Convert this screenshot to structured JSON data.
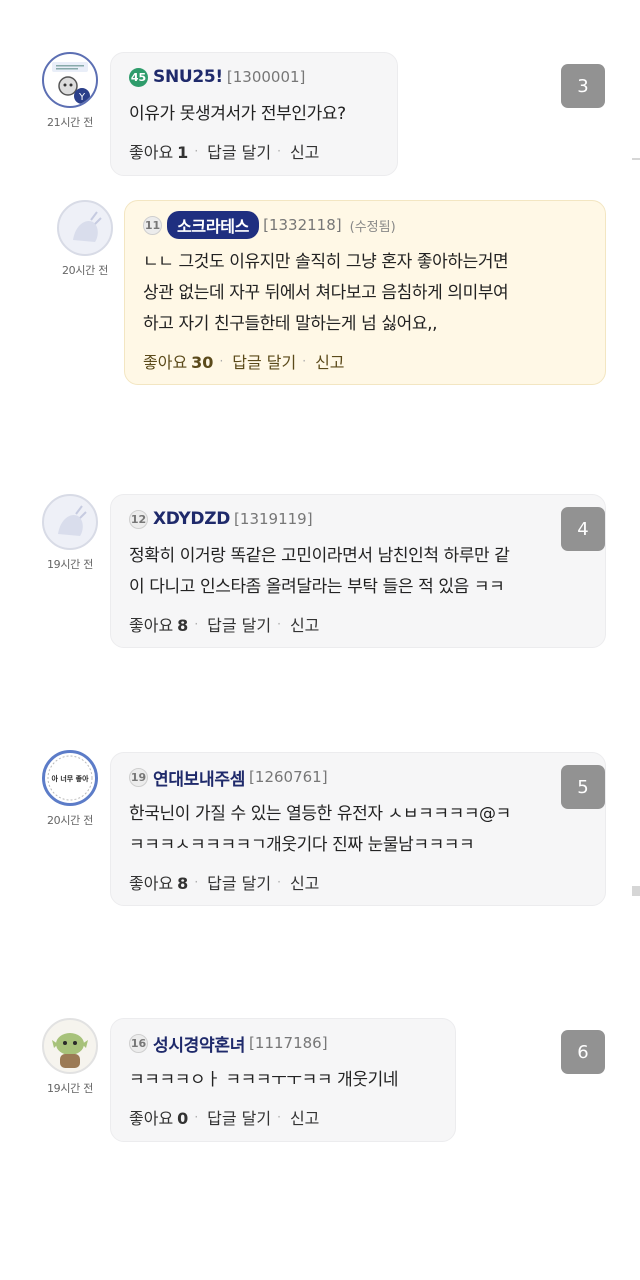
{
  "comments": [
    {
      "level": "45",
      "nickname": "SNU25!",
      "user_id": "[1300001]",
      "edited": "",
      "time": "21시간 전",
      "text_lines": [
        "이유가 못생겨서가 전부인가요?"
      ],
      "like_label": "좋아요",
      "like_count": "1",
      "reply_label": "답글 달기",
      "report_label": "신고",
      "badge": "3"
    },
    {
      "level": "11",
      "nickname": "소크라테스",
      "user_id": "[1332118]",
      "edited": "(수정됨)",
      "time": "20시간 전",
      "text_lines": [
        "ㄴㄴ 그것도 이유지만 솔직히 그냥 혼자 좋아하는거면",
        "상관 없는데 자꾸 뒤에서 쳐다보고 음침하게 의미부여",
        "하고 자기 친구들한테 말하는게 넘 싫어요,,"
      ],
      "like_label": "좋아요",
      "like_count": "30",
      "reply_label": "답글 달기",
      "report_label": "신고",
      "badge": ""
    },
    {
      "level": "12",
      "nickname": "XDYDZD",
      "user_id": "[1319119]",
      "edited": "",
      "time": "19시간 전",
      "text_lines": [
        "정확히 이거랑 똑같은 고민이라면서 남친인척 하루만 같",
        "이 다니고 인스타좀 올려달라는 부탁 들은 적 있음 ㅋㅋ"
      ],
      "like_label": "좋아요",
      "like_count": "8",
      "reply_label": "답글 달기",
      "report_label": "신고",
      "badge": "4"
    },
    {
      "level": "19",
      "nickname": "연대보내주셈",
      "user_id": "[1260761]",
      "edited": "",
      "time": "20시간 전",
      "avatar_text": "아 너무 좋아",
      "text_lines": [
        "한국닌이 가질 수 있는 열등한 유전자 ㅅㅂㅋㅋㅋㅋ@ㅋ",
        "ㅋㅋㅋㅅㅋㅋㅋㅋㄱ개웃기다 진짜 눈물남ㅋㅋㅋㅋ"
      ],
      "like_label": "좋아요",
      "like_count": "8",
      "reply_label": "답글 달기",
      "report_label": "신고",
      "badge": "5"
    },
    {
      "level": "16",
      "nickname": "성시경약혼녀",
      "user_id": "[1117186]",
      "edited": "",
      "time": "19시간 전",
      "text_lines": [
        "ㅋㅋㅋㅋㅇㅏ ㅋㅋㅋㅜㅜㅋㅋ 개웃기네"
      ],
      "like_label": "좋아요",
      "like_count": "0",
      "reply_label": "답글 달기",
      "report_label": "신고",
      "badge": "6"
    }
  ],
  "colors": {
    "nickname": "#1f2a6b",
    "highlight_bg": "#fff8e6",
    "bubble_bg": "#f6f6f7",
    "level_green": "#2e9c6b",
    "badge_gray": "#8d8d8d"
  },
  "icons": [
    "thumbs-up-text",
    "reply-text",
    "report-text"
  ]
}
